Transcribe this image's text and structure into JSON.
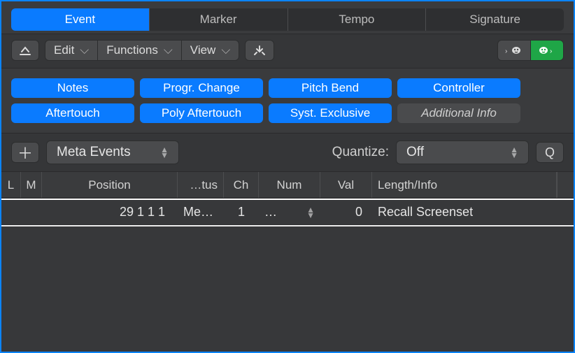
{
  "tabs": {
    "event": "Event",
    "marker": "Marker",
    "tempo": "Tempo",
    "signature": "Signature",
    "active": "event"
  },
  "toolbar": {
    "edit": "Edit",
    "functions": "Functions",
    "view": "View"
  },
  "filters": {
    "notes": "Notes",
    "progr_change": "Progr. Change",
    "pitch_bend": "Pitch Bend",
    "controller": "Controller",
    "aftertouch": "Aftertouch",
    "poly_aftertouch": "Poly Aftertouch",
    "syst_exclusive": "Syst. Exclusive",
    "additional_info": "Additional Info"
  },
  "meta": {
    "type_select": "Meta Events",
    "quantize_label": "Quantize:",
    "quantize_value": "Off",
    "q_button": "Q"
  },
  "columns": {
    "L": "L",
    "M": "M",
    "position": "Position",
    "status": "…tus",
    "ch": "Ch",
    "num": "Num",
    "val": "Val",
    "len": "Length/Info"
  },
  "rows": [
    {
      "position": "29  1  1      1",
      "status": "Me…",
      "ch": "1",
      "num": "…",
      "val": "0",
      "length_info": "Recall Screenset"
    }
  ]
}
